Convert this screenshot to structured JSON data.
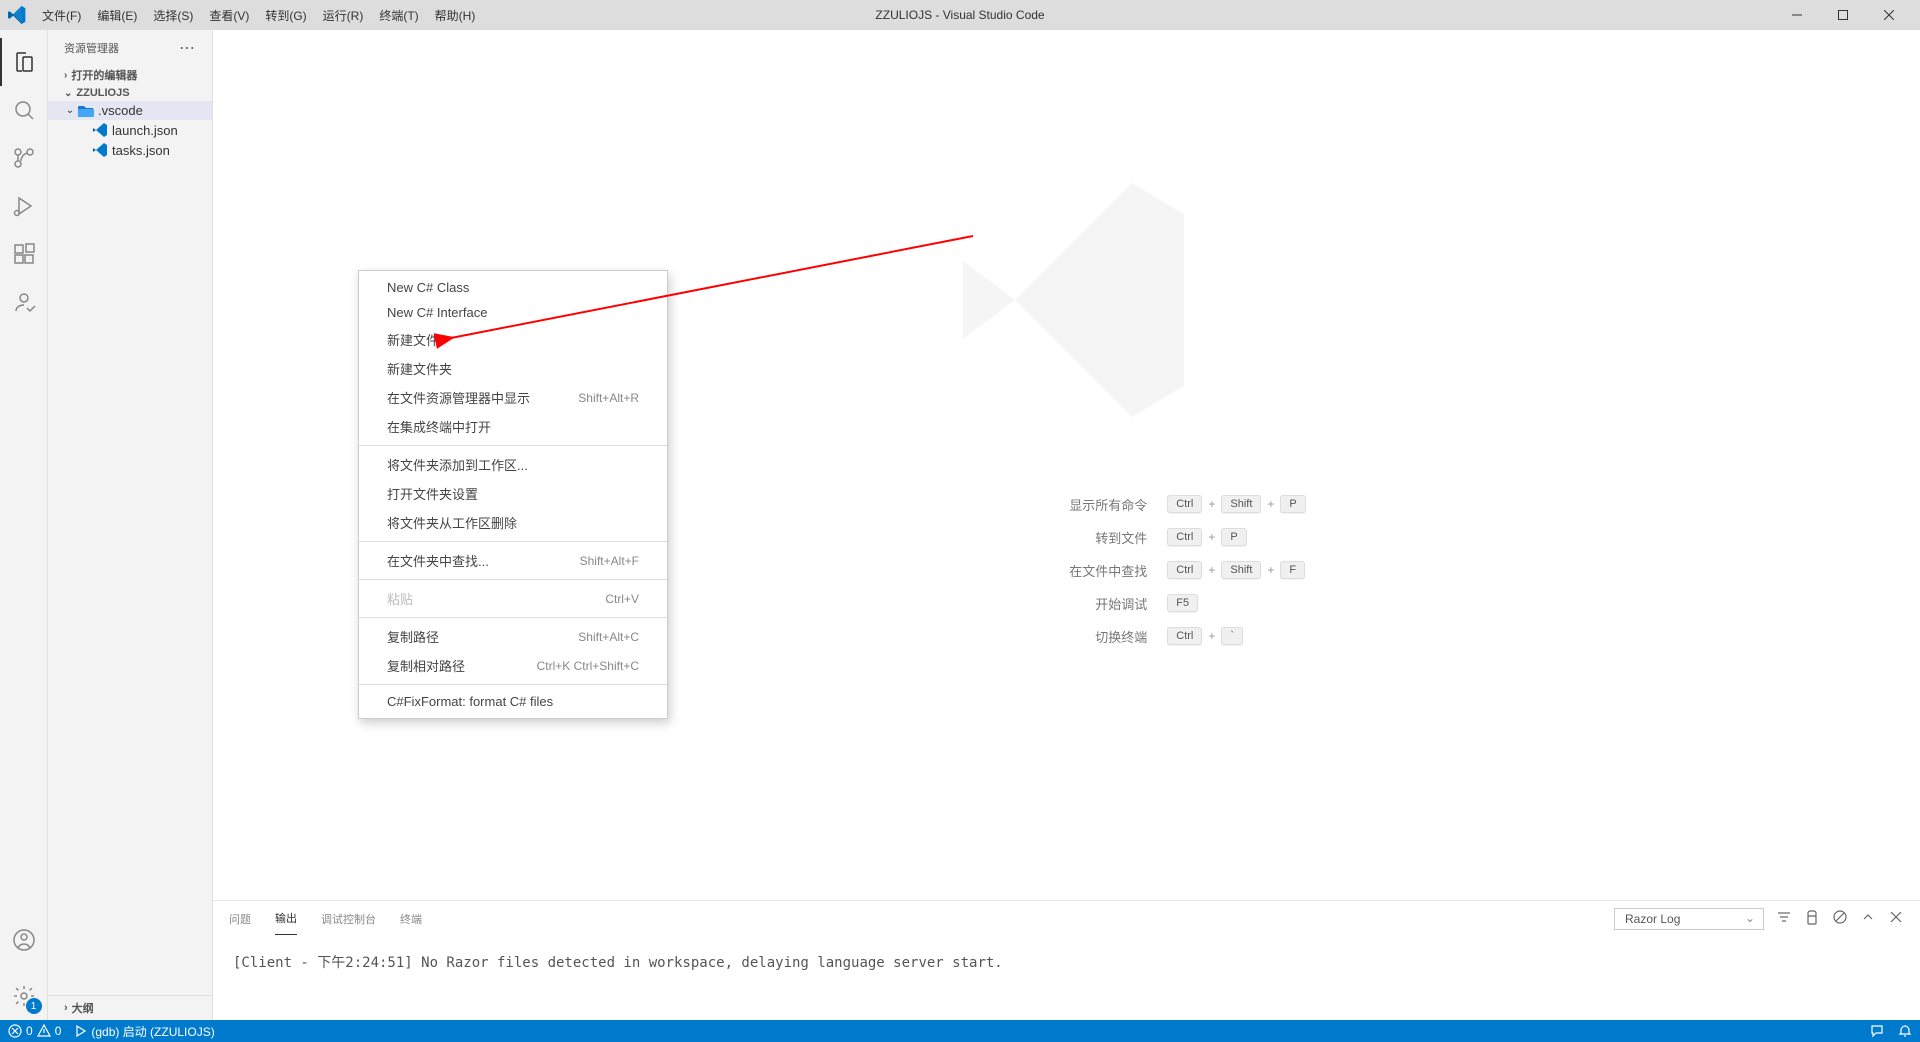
{
  "titlebar": {
    "title": "ZZULIOJS - Visual Studio Code"
  },
  "menu": [
    "文件(F)",
    "编辑(E)",
    "选择(S)",
    "查看(V)",
    "转到(G)",
    "运行(R)",
    "终端(T)",
    "帮助(H)"
  ],
  "sidebar": {
    "header": "资源管理器",
    "open_editors": "打开的编辑器",
    "workspace": "ZZULIOJS",
    "tree": {
      "folder": ".vscode",
      "files": [
        "launch.json",
        "tasks.json"
      ]
    },
    "outline": "大纲"
  },
  "activity_badge": "1",
  "context_menu": {
    "items": [
      {
        "label": "New C# Class",
        "shortcut": "",
        "disabled": false
      },
      {
        "label": "New C# Interface",
        "shortcut": "",
        "disabled": false
      },
      {
        "label": "新建文件",
        "shortcut": "",
        "disabled": false
      },
      {
        "label": "新建文件夹",
        "shortcut": "",
        "disabled": false
      },
      {
        "label": "在文件资源管理器中显示",
        "shortcut": "Shift+Alt+R",
        "disabled": false
      },
      {
        "label": "在集成终端中打开",
        "shortcut": "",
        "disabled": false
      },
      {
        "sep": true
      },
      {
        "label": "将文件夹添加到工作区...",
        "shortcut": "",
        "disabled": false
      },
      {
        "label": "打开文件夹设置",
        "shortcut": "",
        "disabled": false
      },
      {
        "label": "将文件夹从工作区删除",
        "shortcut": "",
        "disabled": false
      },
      {
        "sep": true
      },
      {
        "label": "在文件夹中查找...",
        "shortcut": "Shift+Alt+F",
        "disabled": false
      },
      {
        "sep": true
      },
      {
        "label": "粘贴",
        "shortcut": "Ctrl+V",
        "disabled": true
      },
      {
        "sep": true
      },
      {
        "label": "复制路径",
        "shortcut": "Shift+Alt+C",
        "disabled": false
      },
      {
        "label": "复制相对路径",
        "shortcut": "Ctrl+K Ctrl+Shift+C",
        "disabled": false
      },
      {
        "sep": true
      },
      {
        "label": "C#FixFormat: format C# files",
        "shortcut": "",
        "disabled": false
      }
    ]
  },
  "welcome": {
    "shortcuts": [
      {
        "label": "显示所有命令",
        "keys": [
          "Ctrl",
          "+",
          "Shift",
          "+",
          "P"
        ]
      },
      {
        "label": "转到文件",
        "keys": [
          "Ctrl",
          "+",
          "P"
        ]
      },
      {
        "label": "在文件中查找",
        "keys": [
          "Ctrl",
          "+",
          "Shift",
          "+",
          "F"
        ]
      },
      {
        "label": "开始调试",
        "keys": [
          "F5"
        ]
      },
      {
        "label": "切换终端",
        "keys": [
          "Ctrl",
          "+",
          "`"
        ]
      }
    ]
  },
  "panel": {
    "tabs": [
      "问题",
      "输出",
      "调试控制台",
      "终端"
    ],
    "active_tab": 1,
    "select": "Razor Log",
    "output": "[Client - 下午2:24:51] No Razor files detected in workspace, delaying language server start."
  },
  "statusbar": {
    "errors": "0",
    "warnings": "0",
    "launch": "(gdb) 启动 (ZZULIOJS)"
  }
}
